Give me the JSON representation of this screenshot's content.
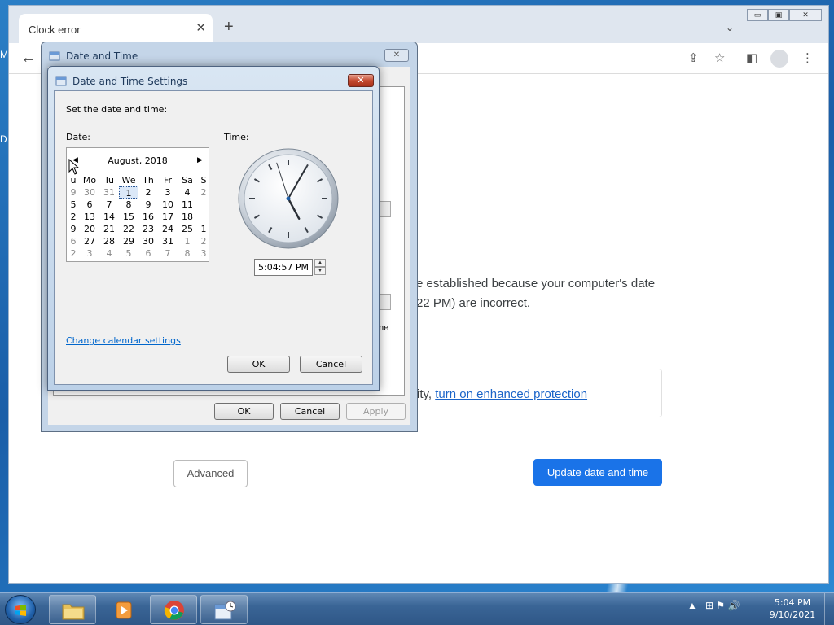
{
  "desktop": {
    "label_m": "M",
    "label_d": "D"
  },
  "browser": {
    "tab_title": "Clock error",
    "tab_close": "✕",
    "new_tab": "+",
    "tab_dropdown": "⌄",
    "win_min": "▭",
    "win_max": "▣",
    "win_close": "✕",
    "back": "←",
    "share_icon": "⇪",
    "star_icon": "☆",
    "sidepanel_icon": "◧",
    "menu_icon": "⋮"
  },
  "page": {
    "text_line1": "e established because your computer's date",
    "text_line2": "22 PM) are incorrect.",
    "protect_prefix": "ity, ",
    "protect_link": "turn on enhanced protection",
    "advanced": "Advanced",
    "update": "Update date and time",
    "partial_me": "me"
  },
  "dt_outer": {
    "title": "Date and Time",
    "close": "✕",
    "ok": "OK",
    "cancel": "Cancel",
    "apply": "Apply"
  },
  "dts": {
    "title": "Date and Time Settings",
    "close": "✕",
    "instruction": "Set the date and time:",
    "date_label": "Date:",
    "time_label": "Time:",
    "month_year": "August, 2018",
    "prev": "◀",
    "next": "▶",
    "weekdays": [
      "u",
      "Mo",
      "Tu",
      "We",
      "Th",
      "Fr",
      "Sa",
      "S"
    ],
    "weeks": [
      [
        "9",
        "30",
        "31",
        "1",
        "2",
        "3",
        "4",
        "2"
      ],
      [
        "5",
        "6",
        "7",
        "8",
        "9",
        "10",
        "11",
        ""
      ],
      [
        "2",
        "13",
        "14",
        "15",
        "16",
        "17",
        "18",
        ""
      ],
      [
        "9",
        "20",
        "21",
        "22",
        "23",
        "24",
        "25",
        "1"
      ],
      [
        "6",
        "27",
        "28",
        "29",
        "30",
        "31",
        "1",
        "2"
      ],
      [
        "2",
        "3",
        "4",
        "5",
        "6",
        "7",
        "8",
        "3"
      ]
    ],
    "time_value": "5:04:57 PM",
    "spin_up": "▲",
    "spin_down": "▼",
    "calendar_link": "Change calendar settings",
    "ok": "OK",
    "cancel": "Cancel",
    "clock": {
      "hour": 5,
      "minute": 4,
      "second": 57
    }
  },
  "taskbar": {
    "time": "5:04 PM",
    "date": "9/10/2021",
    "tray_arrow": "▲",
    "tray_icons": "⊞ ⚑ 🔊"
  }
}
